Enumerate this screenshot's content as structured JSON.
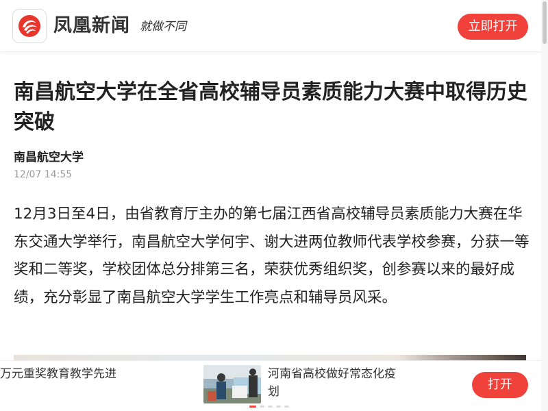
{
  "header": {
    "logo_icon": "phoenix-logo-icon",
    "brand_name": "凤凰新闻",
    "slogan": "就做不同",
    "open_button": "立即打开"
  },
  "article": {
    "title": "南昌航空大学在全省高校辅导员素质能力大赛中取得历史突破",
    "source": "南昌航空大学",
    "time": "12/07 14:55",
    "body": "12月3日至4日，由省教育厅主办的第七届江西省高校辅导员素质能力大赛在华东交通大学举行，南昌航空大学何宇、谢大进两位教师代表学校参赛，分获一等奖和二等奖，学校团体总分排第三名，荣获优秀组织奖，创参赛以来的最好成绩，充分彰显了南昌航空大学学生工作亮点和辅导员风采。"
  },
  "recommendations": {
    "left_text": "万元重奖教育教学先进",
    "right_text": "河南省高校做好常态化疫情防控工作，及时制定计划",
    "right_text_visible": "河南省高校做好常态化疫\n划",
    "open_button": "打开",
    "active_dot_index": 0
  },
  "colors": {
    "accent": "#f0413a",
    "text": "#222222",
    "muted": "#999999"
  }
}
